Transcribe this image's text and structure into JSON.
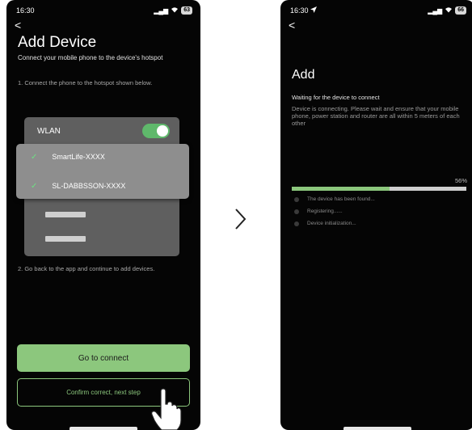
{
  "left_screen": {
    "time": "16:30",
    "battery": "63",
    "back_glyph": "<",
    "title": "Add Device",
    "subtitle": "Connect your mobile phone to the device's hotspot",
    "step1": "1. Connect the phone to the hotspot shown below.",
    "wlan_label": "WLAN",
    "wlan_on": true,
    "networks": [
      {
        "name": "SmartLife-XXXX",
        "connected": true
      },
      {
        "name": "SL-DABBSSON-XXXX",
        "connected": true
      }
    ],
    "step2": "2. Go back to the app and continue to add devices.",
    "go_button": "Go to connect",
    "next_button": "Confirm correct, next step"
  },
  "right_screen": {
    "time": "16:30",
    "battery": "66",
    "back_glyph": "<",
    "title": "Add",
    "waiting": "Waiting for the device to connect",
    "description": "Device is connecting. Please wait and ensure that your mobile phone, power station and router are all within 5 meters of each other",
    "progress_percent": 56,
    "progress_label": "56%",
    "status_items": [
      "The device has been found...",
      "Registering......",
      "Device initialization..."
    ]
  },
  "colors": {
    "accent_green": "#8cc77d",
    "toggle_green": "#5fb86b",
    "background": "#050505",
    "panel_gray": "#5f5f5f",
    "popup_gray": "#8e8e8e"
  },
  "icons": [
    "signal-icon",
    "wifi-icon",
    "battery-icon",
    "back-icon",
    "check-icon",
    "chevron-right-icon",
    "hand-pointer-icon",
    "location-arrow-icon"
  ]
}
